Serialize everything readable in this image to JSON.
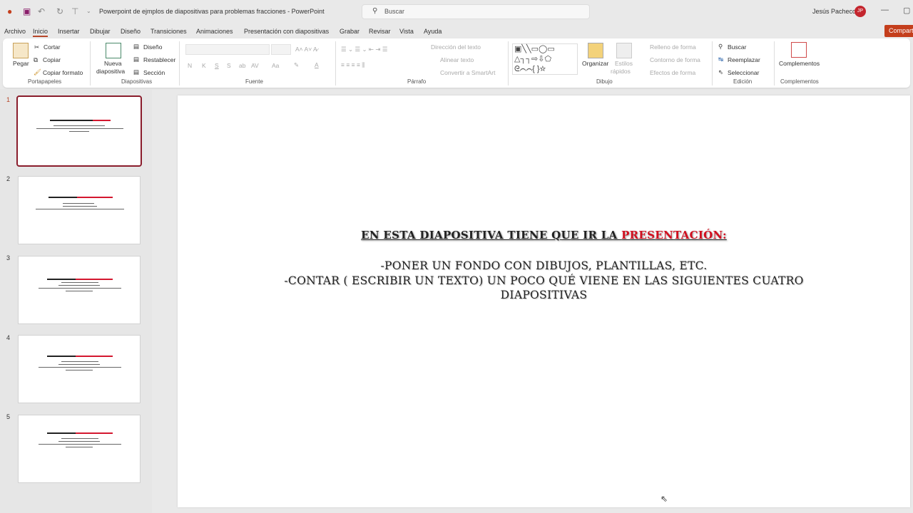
{
  "titlebar": {
    "title": "Powerpoint de ejmplos de diapositivas para problemas fracciones  -  PowerPoint",
    "search_placeholder": "Buscar",
    "user": "Jesús Pacheco",
    "initials": "JP"
  },
  "menu": {
    "tabs": [
      "Archivo",
      "Inicio",
      "Insertar",
      "Dibujar",
      "Diseño",
      "Transiciones",
      "Animaciones",
      "Presentación con diapositivas",
      "Grabar",
      "Revisar",
      "Vista",
      "Ayuda"
    ],
    "active": "Inicio",
    "share": "Compartir"
  },
  "ribbon": {
    "portapapeles": {
      "paste": "Pegar",
      "cut": "Cortar",
      "copy": "Copiar",
      "format": "Copiar formato",
      "label": "Portapapeles"
    },
    "diapositivas": {
      "new1": "Nueva",
      "new2": "diapositiva",
      "layout": "Diseño",
      "reset": "Restablecer",
      "section": "Sección",
      "label": "Diapositivas"
    },
    "fuente": {
      "label": "Fuente",
      "bold": "N",
      "italic": "K",
      "underline": "S",
      "shadow": "S",
      "strike": "ab",
      "spacing": "AV",
      "case": "Aa"
    },
    "parrafo": {
      "direction": "Dirección del texto",
      "align": "Alinear texto",
      "smartart": "Convertir a SmartArt",
      "label": "Párrafo"
    },
    "dibujo": {
      "arrange": "Organizar",
      "styles1": "Estilos",
      "styles2": "rápidos",
      "fill": "Relleno de forma",
      "outline": "Contorno de forma",
      "effects": "Efectos de forma",
      "label": "Dibujo"
    },
    "edicion": {
      "find": "Buscar",
      "replace": "Reemplazar",
      "select": "Seleccionar",
      "label": "Edición"
    },
    "complementos": {
      "button": "Complementos",
      "label": "Complementos"
    }
  },
  "slides": {
    "numbers": [
      "1",
      "2",
      "3",
      "4",
      "5"
    ],
    "selected": 1
  },
  "slide": {
    "title_black": "En esta diapositiva tiene que ir la ",
    "title_red": "presentación:",
    "line1": "-Poner un fondo con dibujos, plantillas, etc.",
    "line2": "-Contar  ( escribir un texto)  un poco qué viene en las siguientes cuatro",
    "line3": "diapositivas"
  }
}
